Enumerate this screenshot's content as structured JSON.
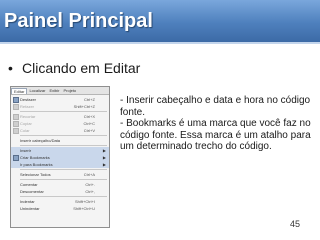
{
  "slide": {
    "title": "Painel Principal",
    "bullet": "Clicando em Editar",
    "description": [
      "- Inserir cabeçalho e data e hora no código fonte.",
      "- Bookmarks é uma marca que você faz no código fonte. Essa marca é um atalho para um determinado trecho do código."
    ],
    "page_number": "45",
    "colors": {
      "title_bar": "#4e80bd",
      "title_text": "#ffffff"
    }
  },
  "menu_screenshot": {
    "menu_bar": [
      "Editar",
      "Localizar",
      "Exibir",
      "Projeto"
    ],
    "items": [
      {
        "label": "Desfazer",
        "shortcut": "Ctrl+Z"
      },
      {
        "label": "Refazer",
        "shortcut": "Shift+Ctrl+Z"
      },
      {
        "label": "Recortar",
        "shortcut": "Ctrl+X"
      },
      {
        "label": "Copiar",
        "shortcut": "Ctrl+C"
      },
      {
        "label": "Colar",
        "shortcut": "Ctrl+V"
      },
      {
        "label": "Inserir cabeçalho/Data",
        "shortcut": ""
      },
      {
        "label": "Inserir",
        "shortcut": ""
      },
      {
        "label": "Criar Bookmarks",
        "shortcut": ""
      },
      {
        "label": "Ir para Bookmarks",
        "shortcut": ""
      },
      {
        "label": "Selecionar Todos",
        "shortcut": "Ctrl+A"
      },
      {
        "label": "Comentar",
        "shortcut": "Ctrl+."
      },
      {
        "label": "Descomentar",
        "shortcut": "Ctrl+,"
      },
      {
        "label": "Indentar",
        "shortcut": "Shift+Ctrl+I"
      },
      {
        "label": "Unindentar",
        "shortcut": "Shift+Ctrl+U"
      }
    ]
  }
}
